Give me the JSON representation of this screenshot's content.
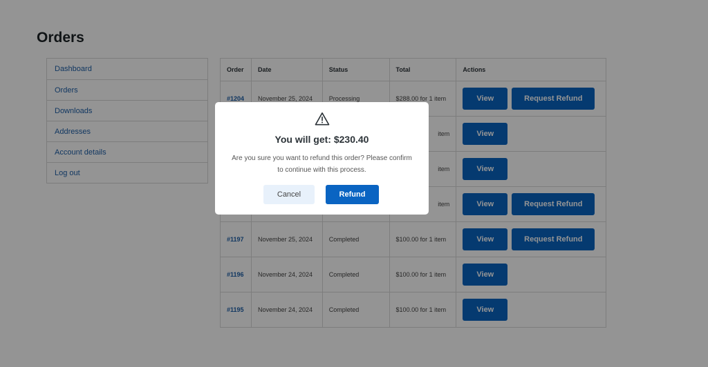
{
  "page": {
    "title": "Orders"
  },
  "nav": {
    "items": [
      {
        "label": "Dashboard"
      },
      {
        "label": "Orders"
      },
      {
        "label": "Downloads"
      },
      {
        "label": "Addresses"
      },
      {
        "label": "Account details"
      },
      {
        "label": "Log out"
      }
    ]
  },
  "table": {
    "headers": {
      "order": "Order",
      "date": "Date",
      "status": "Status",
      "total": "Total",
      "actions": "Actions"
    },
    "view_label": "View",
    "refund_label": "Request Refund",
    "rows": [
      {
        "order": "#1204",
        "date": "November 25, 2024",
        "status": "Processing",
        "total": "$288.00 for 1 item",
        "refund": true
      },
      {
        "order": "",
        "date": "",
        "status": "",
        "total": "item",
        "refund": false
      },
      {
        "order": "",
        "date": "",
        "status": "",
        "total": "item",
        "refund": false
      },
      {
        "order": "",
        "date": "",
        "status": "",
        "total": "item",
        "refund": true
      },
      {
        "order": "#1197",
        "date": "November 25, 2024",
        "status": "Completed",
        "total": "$100.00 for 1 item",
        "refund": true
      },
      {
        "order": "#1196",
        "date": "November 24, 2024",
        "status": "Completed",
        "total": "$100.00 for 1 item",
        "refund": false
      },
      {
        "order": "#1195",
        "date": "November 24, 2024",
        "status": "Completed",
        "total": "$100.00 for 1 item",
        "refund": false
      }
    ]
  },
  "modal": {
    "icon": "warning-icon",
    "title": "You will get: $230.40",
    "message": "Are you sure you want to refund this order? Please confirm to continue with this process.",
    "cancel_label": "Cancel",
    "confirm_label": "Refund"
  },
  "colors": {
    "accent": "#0a64c2",
    "link": "#1e5fa8",
    "overlay": "rgba(0,0,0,0.42)"
  }
}
